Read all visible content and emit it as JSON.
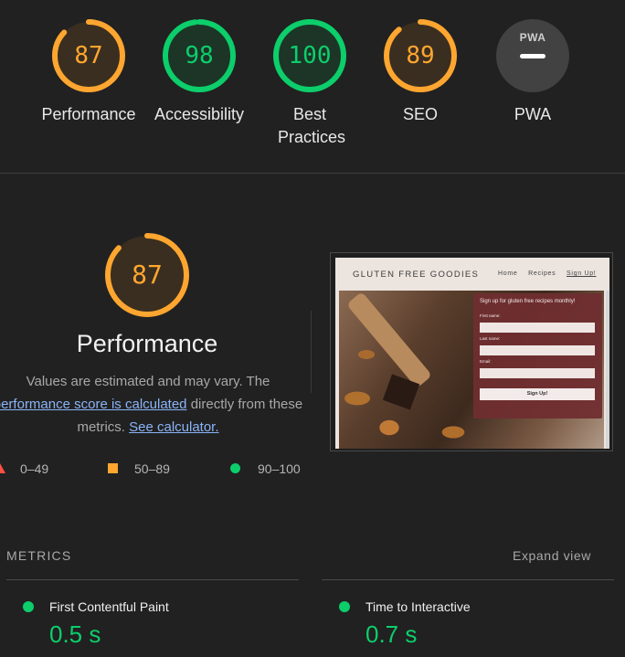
{
  "colors": {
    "pass": "#0cce6b",
    "average": "#ffa630",
    "fail": "#ff4e42",
    "link": "#8ab4f8",
    "background": "#212121"
  },
  "categories": [
    {
      "score": "87",
      "label": "Performance",
      "color": "#ffa630",
      "fraction": 0.87
    },
    {
      "score": "98",
      "label": "Accessibility",
      "color": "#0cce6b",
      "fraction": 0.98
    },
    {
      "score": "100",
      "label": "Best Practices",
      "color": "#0cce6b",
      "fraction": 1.0
    },
    {
      "score": "89",
      "label": "SEO",
      "color": "#ffa630",
      "fraction": 0.89
    }
  ],
  "pwa": {
    "badge_text": "PWA",
    "label": "PWA",
    "icon": "pwa-dash-icon"
  },
  "performance": {
    "score": "87",
    "fraction": 0.87,
    "title": "Performance",
    "desc_prefix": "Values are estimated and may vary. The",
    "desc_link": "performance score is calculated",
    "desc_mid": "directly from these metrics.",
    "desc_calc_link": "See calculator."
  },
  "legend": [
    {
      "range": "0–49",
      "shape": "triangle"
    },
    {
      "range": "50–89",
      "shape": "square"
    },
    {
      "range": "90–100",
      "shape": "circle"
    }
  ],
  "screenshot": {
    "brand": "GLUTEN FREE GOODIES",
    "nav": [
      "Home",
      "Recipes",
      "Sign Up!"
    ],
    "form_title": "Sign up for gluten free recipes monthly!",
    "fields": [
      "First name:",
      "Last name:",
      "Email:"
    ],
    "button": "Sign Up!"
  },
  "metrics": {
    "title": "METRICS",
    "expand": "Expand view",
    "items": [
      {
        "label": "First Contentful Paint",
        "value": "0.5 s"
      },
      {
        "label": "Time to Interactive",
        "value": "0.7 s"
      }
    ]
  }
}
